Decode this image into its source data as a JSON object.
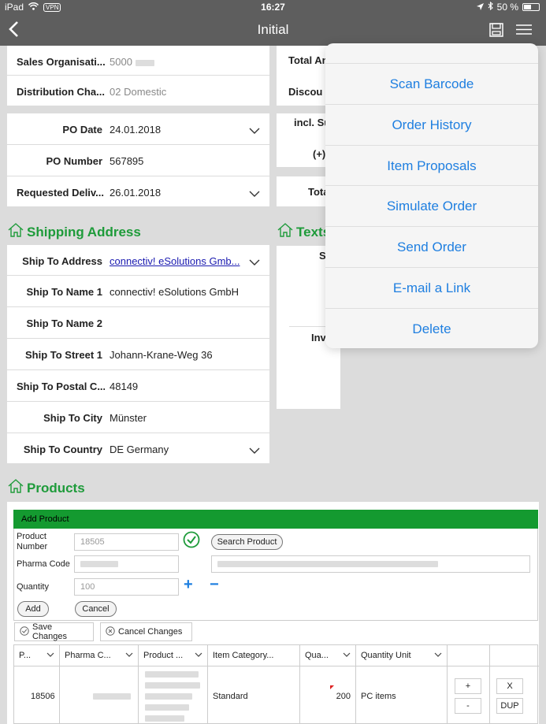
{
  "status": {
    "device": "iPad",
    "vpn": "VPN",
    "time": "16:27",
    "battery": "50 %",
    "battery_level": 0.5
  },
  "nav": {
    "title": "Initial"
  },
  "sales": [
    {
      "label": "Sales Organisati...",
      "value": "5000"
    },
    {
      "label": "Distribution Cha...",
      "value": "02 Domestic"
    }
  ],
  "po": {
    "date_label": "PO Date",
    "date_value": "24.01.2018",
    "number_label": "PO Number",
    "number_value": "567895",
    "req_label": "Requested Deliv...",
    "req_value": "26.01.2018"
  },
  "right_partial": {
    "total_amount": "Total An",
    "discount": "Discou",
    "incl": "incl. Su",
    "plus": "(+)",
    "total": "Tota",
    "texts": "Texts",
    "s": "S",
    "inv": "Inv"
  },
  "shipping": {
    "title": "Shipping Address",
    "rows": [
      {
        "label": "Ship To Address",
        "value": "connectiv! eSolutions Gmb..."
      },
      {
        "label": "Ship To Name 1",
        "value": "connectiv! eSolutions GmbH"
      },
      {
        "label": "Ship To Name 2",
        "value": ""
      },
      {
        "label": "Ship To Street 1",
        "value": "Johann-Krane-Weg 36"
      },
      {
        "label": "Ship To Postal C...",
        "value": "48149"
      },
      {
        "label": "Ship To City",
        "value": "Münster"
      },
      {
        "label": "Ship To Country",
        "value": "DE Germany"
      }
    ]
  },
  "menu": {
    "items": [
      "Scan Barcode",
      "Order History",
      "Item Proposals",
      "Simulate Order",
      "Send Order",
      "E-mail a Link",
      "Delete"
    ]
  },
  "products": {
    "title": "Products",
    "add_title": "Add Product",
    "product_number_label": "Product Number",
    "product_number_value": "18505",
    "search_label": "Search Product",
    "pharma_label": "Pharma Code",
    "quantity_label": "Quantity",
    "quantity_value": "100",
    "plus": "+",
    "minus": "−",
    "add_label": "Add",
    "cancel_label": "Cancel",
    "save_changes": "Save Changes",
    "cancel_changes": "Cancel Changes",
    "columns": [
      "P...",
      "Pharma C...",
      "Product ...",
      "Item Category...",
      "Qua...",
      "Quantity Unit"
    ],
    "row": {
      "product": "18506",
      "category": "Standard",
      "quantity": "200",
      "unit": "PC items",
      "plus": "+",
      "minus": "-",
      "x": "X",
      "dup": "DUP"
    }
  },
  "colors": {
    "accent_green": "#1e9b3a",
    "bar_green": "#149a30",
    "ios_blue": "#1f7fe0",
    "nav_grey": "#5e5e5e"
  }
}
